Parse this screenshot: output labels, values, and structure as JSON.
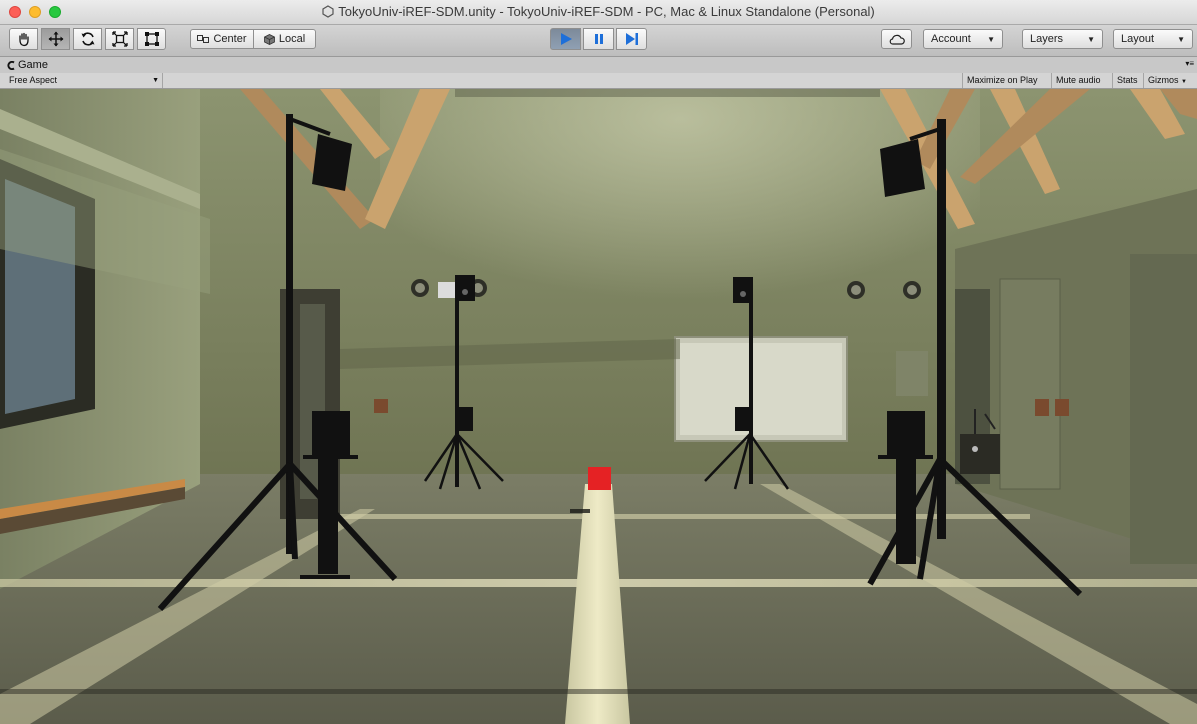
{
  "window": {
    "title": "TokyoUniv-iREF-SDM.unity - TokyoUniv-iREF-SDM - PC, Mac & Linux Standalone (Personal)"
  },
  "toolbar": {
    "tools": [
      "hand-tool",
      "move-tool",
      "rotate-tool",
      "scale-tool",
      "rect-tool"
    ],
    "pivot_label": "Center",
    "space_label": "Local",
    "account_label": "Account",
    "layers_label": "Layers",
    "layout_label": "Layout"
  },
  "game": {
    "tab_label": "Game",
    "aspect_label": "Free Aspect",
    "maximize_label": "Maximize on Play",
    "mute_label": "Mute audio",
    "stats_label": "Stats",
    "gizmos_label": "Gizmos"
  },
  "colors": {
    "play_accent": "#1e6fd9",
    "scene_red_cube": "#e52224"
  }
}
